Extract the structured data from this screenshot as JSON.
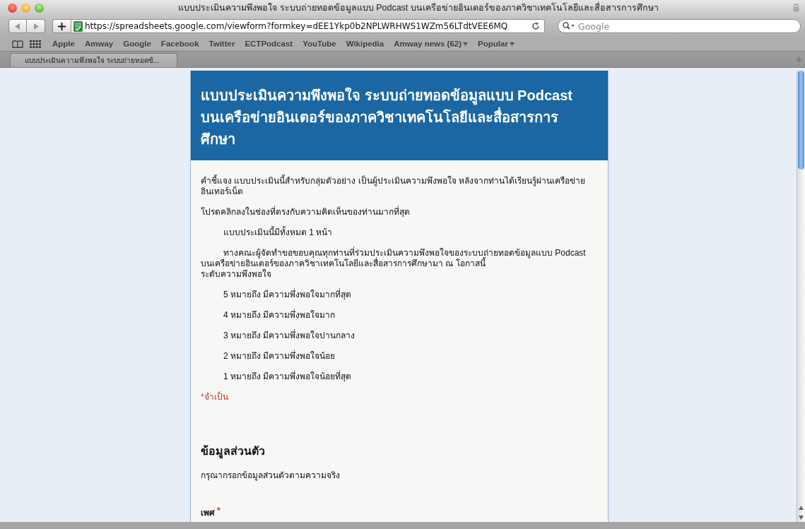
{
  "window": {
    "title": "แบบประเมินความพึงพอใจ ระบบถ่ายทอดข้อมูลแบบ Podcast บนเครือข่ายอินเตอร์ของภาควิชาเทคโนโลยีและสื่อสารการศึกษา"
  },
  "toolbar": {
    "url": "https://spreadsheets.google.com/viewform?formkey=dEE1Ykp0b2NPLWRHWS1WZm56LTdtVEE6MQ",
    "search": {
      "placeholder": "Google"
    }
  },
  "bookmarks": [
    {
      "label": "Apple",
      "kind": "link"
    },
    {
      "label": "Amway",
      "kind": "link"
    },
    {
      "label": "Google",
      "kind": "link"
    },
    {
      "label": "Facebook",
      "kind": "link"
    },
    {
      "label": "Twitter",
      "kind": "link"
    },
    {
      "label": "ECTPodcast",
      "kind": "link"
    },
    {
      "label": "YouTube",
      "kind": "link"
    },
    {
      "label": "Wikipedia",
      "kind": "link"
    },
    {
      "label": "Amway news (62)",
      "kind": "menu"
    },
    {
      "label": "Popular",
      "kind": "menu"
    }
  ],
  "tabs": [
    {
      "label": "แบบประเมินความพึงพอใจ ระบบถ่ายทอดข้...",
      "selected": true
    }
  ],
  "form": {
    "title": "แบบประเมินความพึงพอใจ ระบบถ่ายทอดข้อมูลแบบ Podcast บนเครือข่ายอินเตอร์ของภาควิชาเทคโนโลยีและสื่อสารการศึกษา",
    "paragraphs": [
      {
        "indent": false,
        "lines": [
          "คำชี้แจง  แบบประเมินนี้สำหรับกลุ่มตัวอย่าง เป็นผู้ประเมินความพึงพอใจ หลังจากท่านได้เรียนรู้ผ่านเครือข่ายอินเทอร์เน็ต"
        ]
      },
      {
        "indent": false,
        "lines": [
          "โปรดคลิกลงในช่องที่ตรงกับความคิดเห็นของท่านมากที่สุด"
        ]
      },
      {
        "indent": true,
        "lines": [
          "แบบประเมินนี้มีทั้งหมด 1 หน้า"
        ]
      },
      {
        "indent": true,
        "lines": [
          "ทางคณะผู้จัดทำขอขอบคุณทุกท่านที่ร่วมประเมินความพึงพอใจของระบบถ่ายทอดข้อมูลแบบ Podcast บนเครือข่ายอินเตอร์ของภาควิชาเทคโนโลยีและสื่อสารการศึกษามา ณ โอกาสนี้",
          "ระดับความพึงพอใจ"
        ]
      },
      {
        "indent": true,
        "lines": [
          "5 หมายถึง มีความพึ่งพอใจมากที่สุด"
        ]
      },
      {
        "indent": true,
        "lines": [
          "4 หมายถึง มีความพึ่งพอใจมาก"
        ]
      },
      {
        "indent": true,
        "lines": [
          "3 หมายถึง มีความพึ่งพอใจปานกลาง"
        ]
      },
      {
        "indent": true,
        "lines": [
          "2 หมายถึง มีความพึ่งพอใจน้อย"
        ]
      },
      {
        "indent": true,
        "lines": [
          "1 หมายถึง มีความพึ่งพอใจน้อยที่สุด"
        ]
      }
    ],
    "required_note": "*จำเป็น",
    "section": {
      "title": "ข้อมูลส่วนตัว",
      "description": "กรุณากรอกข้อมูลส่วนตัวตามความจริง"
    },
    "question": {
      "label": "เพศ",
      "required": true,
      "required_mark": "*"
    }
  }
}
